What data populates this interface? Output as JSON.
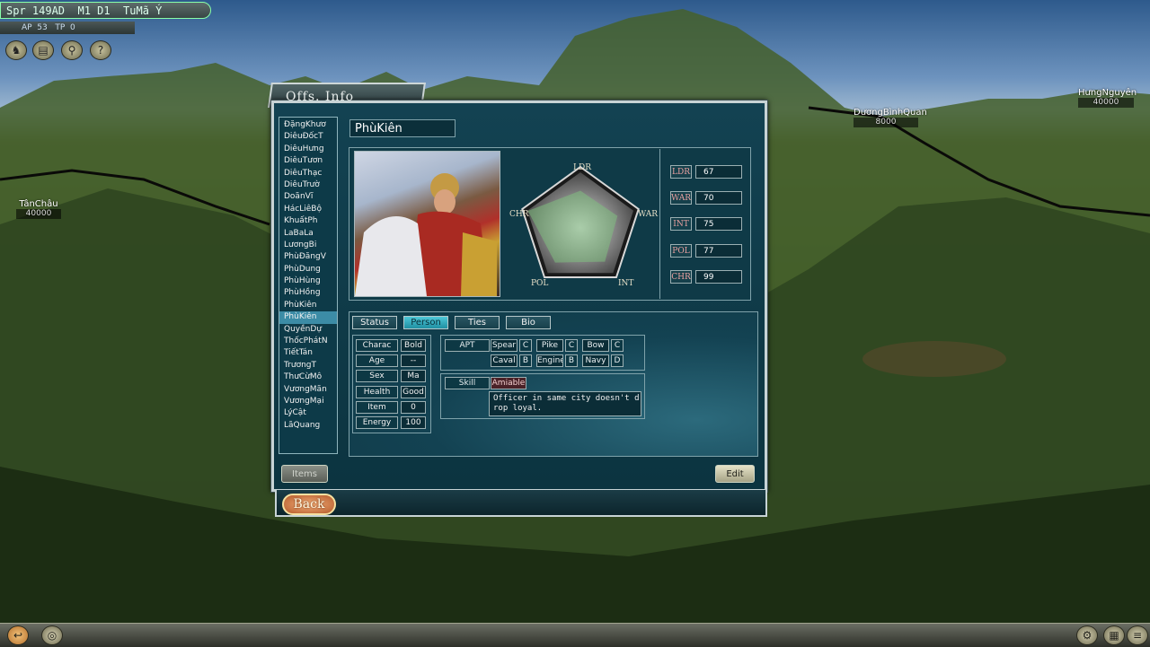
{
  "hud": {
    "line1": "Spr 149AD  M1 D1  TuMã Ý",
    "line2": "AP  53   TP  0",
    "icons": [
      "horse-icon",
      "scroll-icon",
      "magnifier-icon",
      "help-icon"
    ],
    "icon_glyphs": [
      "♞",
      "▤",
      "⚲",
      "?"
    ]
  },
  "map_regions": [
    {
      "name": "TânChâu",
      "value": "40000"
    },
    {
      "name": "DươngBìnhQuan",
      "value": "8000"
    },
    {
      "name": "HưngNguyên",
      "value": "40000"
    }
  ],
  "panel": {
    "title": "Offs. Info",
    "officer_list": [
      "ĐặngKhươ",
      "DiêuĐốcT",
      "DiêuHưng",
      "DiêuTươn",
      "DiêuThạc",
      "DiêuTrườ",
      "DoãnVĩ",
      "HácLiêBộ",
      "KhuấtPh",
      "LaBaLa",
      "LươngBi",
      "PhùĐăngV",
      "PhùDung",
      "PhùHùng",
      "PhùHồng",
      "PhùKiên",
      "PhùKiên",
      "QuyềnDự",
      "ThốcPhátN",
      "TiếtTán",
      "TrươngT",
      "ThưCừMô",
      "VươngMãn",
      "VươngMại",
      "LýCật",
      "LãQuang"
    ],
    "selected_index": 16,
    "officer_name": "PhùKiên",
    "pentagon_labels": {
      "top": "LDR",
      "right": "WAR",
      "bottom_right": "INT",
      "bottom_left": "POL",
      "left": "CHR"
    },
    "stats": [
      {
        "key": "LDR",
        "value": "67"
      },
      {
        "key": "WAR",
        "value": "70"
      },
      {
        "key": "INT",
        "value": "75"
      },
      {
        "key": "POL",
        "value": "77"
      },
      {
        "key": "CHR",
        "value": "99"
      }
    ],
    "stat_max": 100,
    "tabs": [
      "Status",
      "Person",
      "Ties",
      "Bio"
    ],
    "active_tab": "Person",
    "attributes": [
      {
        "key": "Charac",
        "value": "Bold"
      },
      {
        "key": "Age",
        "value": "--"
      },
      {
        "key": "Sex",
        "value": "Ma"
      },
      {
        "key": "Health",
        "value": "Good"
      },
      {
        "key": "Item",
        "value": "0"
      },
      {
        "key": "Energy",
        "value": "100"
      }
    ],
    "apt_label": "APT",
    "aptitudes": [
      {
        "weapon": "Spear",
        "grade": "C"
      },
      {
        "weapon": "Pike",
        "grade": "C"
      },
      {
        "weapon": "Bow",
        "grade": "C"
      },
      {
        "weapon": "Caval",
        "grade": "B"
      },
      {
        "weapon": "Engine",
        "grade": "B"
      },
      {
        "weapon": "Navy",
        "grade": "D"
      }
    ],
    "skill_label": "Skill",
    "skill_name": "Amiable",
    "skill_desc": "Officer in same city doesn't d\nrop loyal.",
    "items_button": "Items",
    "edit_button": "Edit",
    "back_button": "Back"
  },
  "colors": {
    "accent": "#3c8ca6",
    "active_tab": "#4ec8d8",
    "stat_key_text": "#e9a0a0"
  }
}
